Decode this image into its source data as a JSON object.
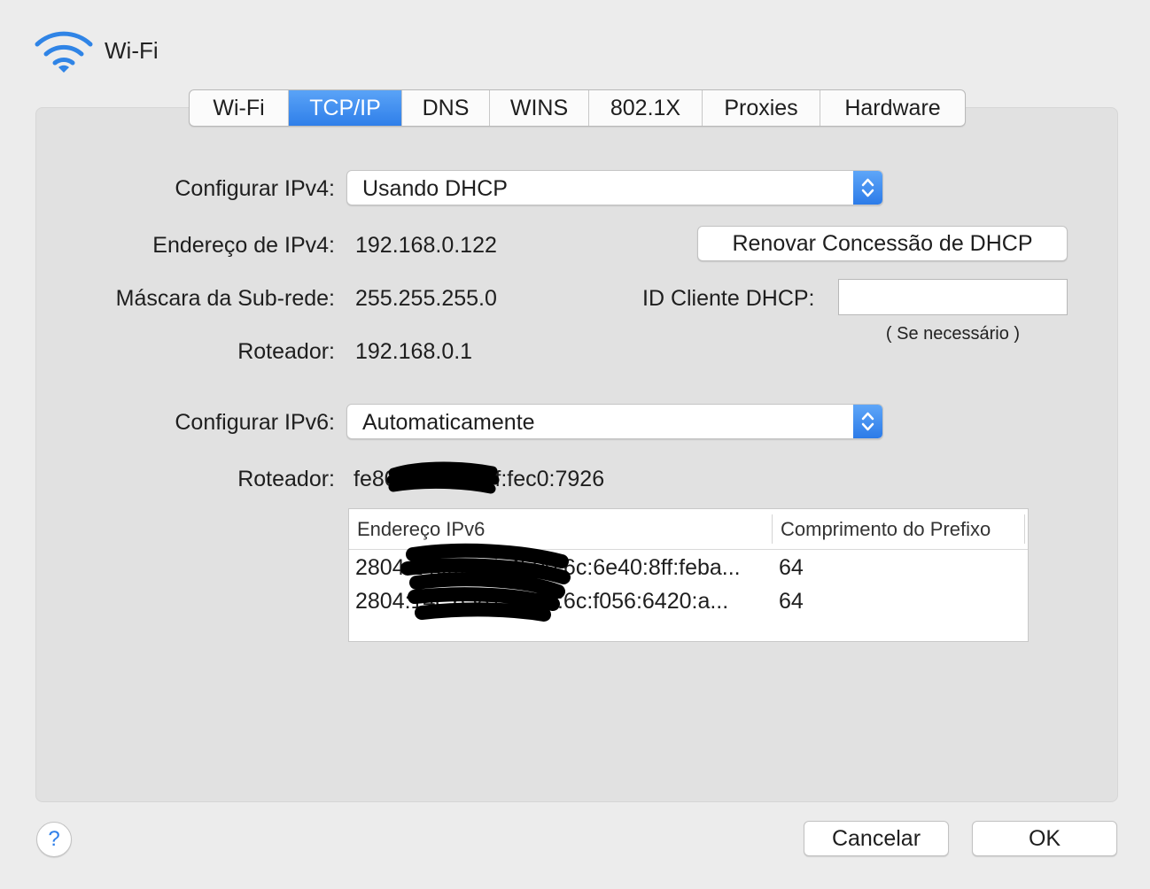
{
  "header": {
    "title": "Wi-Fi",
    "icon": "wifi-icon"
  },
  "tabs": [
    {
      "label": "Wi-Fi",
      "active": false
    },
    {
      "label": "TCP/IP",
      "active": true
    },
    {
      "label": "DNS",
      "active": false
    },
    {
      "label": "WINS",
      "active": false
    },
    {
      "label": "802.1X",
      "active": false
    },
    {
      "label": "Proxies",
      "active": false
    },
    {
      "label": "Hardware",
      "active": false
    }
  ],
  "ipv4": {
    "configure_label": "Configurar IPv4:",
    "configure_value": "Usando DHCP",
    "address_label": "Endereço de IPv4:",
    "address_value": "192.168.0.122",
    "subnet_label": "Máscara da Sub-rede:",
    "subnet_value": "255.255.255.0",
    "router_label": "Roteador:",
    "router_value": "192.168.0.1"
  },
  "dhcp": {
    "renew_button": "Renovar Concessão de DHCP",
    "client_id_label": "ID Cliente DHCP:",
    "client_id_value": "",
    "client_id_hint": "( Se necessário )"
  },
  "ipv6": {
    "configure_label": "Configurar IPv6:",
    "configure_value": "Automaticamente",
    "router_label": "Roteador:",
    "router_value": "fe80::8605:84ff:fec0:7926",
    "table": {
      "columns": [
        "Endereço IPv6",
        "Comprimento do Prefixo"
      ],
      "rows": [
        [
          "2804:14c:6581:4b00:6c:6e40:8ff:feba...",
          "64"
        ],
        [
          "2804:14c:6581:4b00:6c:f056:6420:a...",
          "64"
        ]
      ]
    }
  },
  "footer": {
    "help": "?",
    "cancel": "Cancelar",
    "ok": "OK"
  },
  "colors": {
    "accent": "#2f7fe9",
    "panel": "#e1e1e1",
    "window": "#ececec"
  }
}
